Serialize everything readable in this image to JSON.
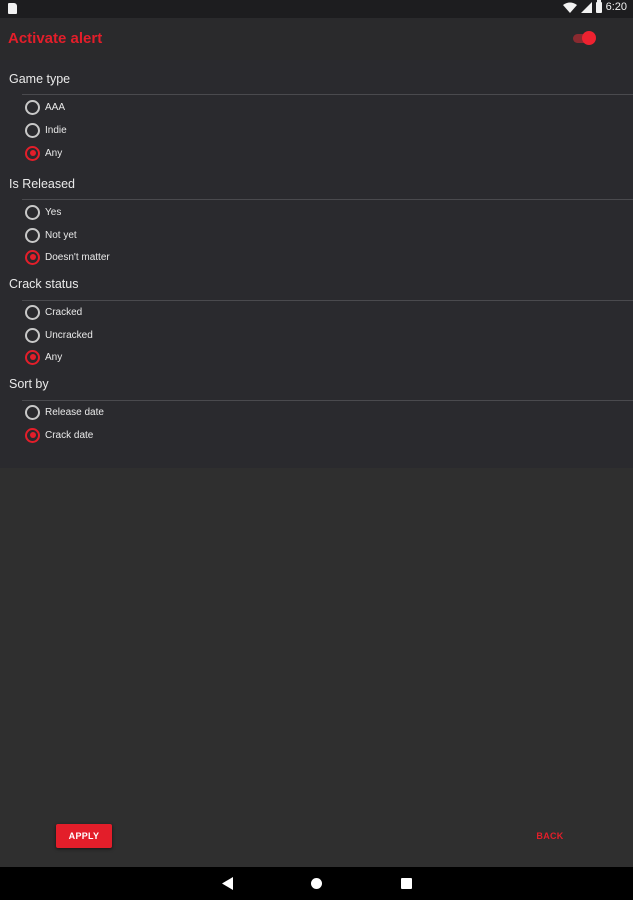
{
  "status_bar": {
    "time": "6:20"
  },
  "app_bar": {
    "title": "Activate alert",
    "toggle_on": true
  },
  "accent_color": "#e31e2a",
  "sections": [
    {
      "title": "Game type",
      "options": [
        {
          "label": "AAA",
          "checked": false
        },
        {
          "label": "Indie",
          "checked": false
        },
        {
          "label": "Any",
          "checked": true
        }
      ]
    },
    {
      "title": "Is Released",
      "options": [
        {
          "label": "Yes",
          "checked": false
        },
        {
          "label": "Not yet",
          "checked": false
        },
        {
          "label": "Doesn't matter",
          "checked": true
        }
      ]
    },
    {
      "title": "Crack status",
      "options": [
        {
          "label": "Cracked",
          "checked": false
        },
        {
          "label": "Uncracked",
          "checked": false
        },
        {
          "label": "Any",
          "checked": true
        }
      ]
    },
    {
      "title": "Sort by",
      "options": [
        {
          "label": "Release date",
          "checked": false
        },
        {
          "label": "Crack date",
          "checked": true
        }
      ]
    }
  ],
  "footer": {
    "apply_label": "APPLY",
    "back_label": "BACK"
  },
  "nav": {
    "back_icon": "triangle-back-icon",
    "home_icon": "circle-home-icon",
    "recent_icon": "square-recents-icon"
  }
}
